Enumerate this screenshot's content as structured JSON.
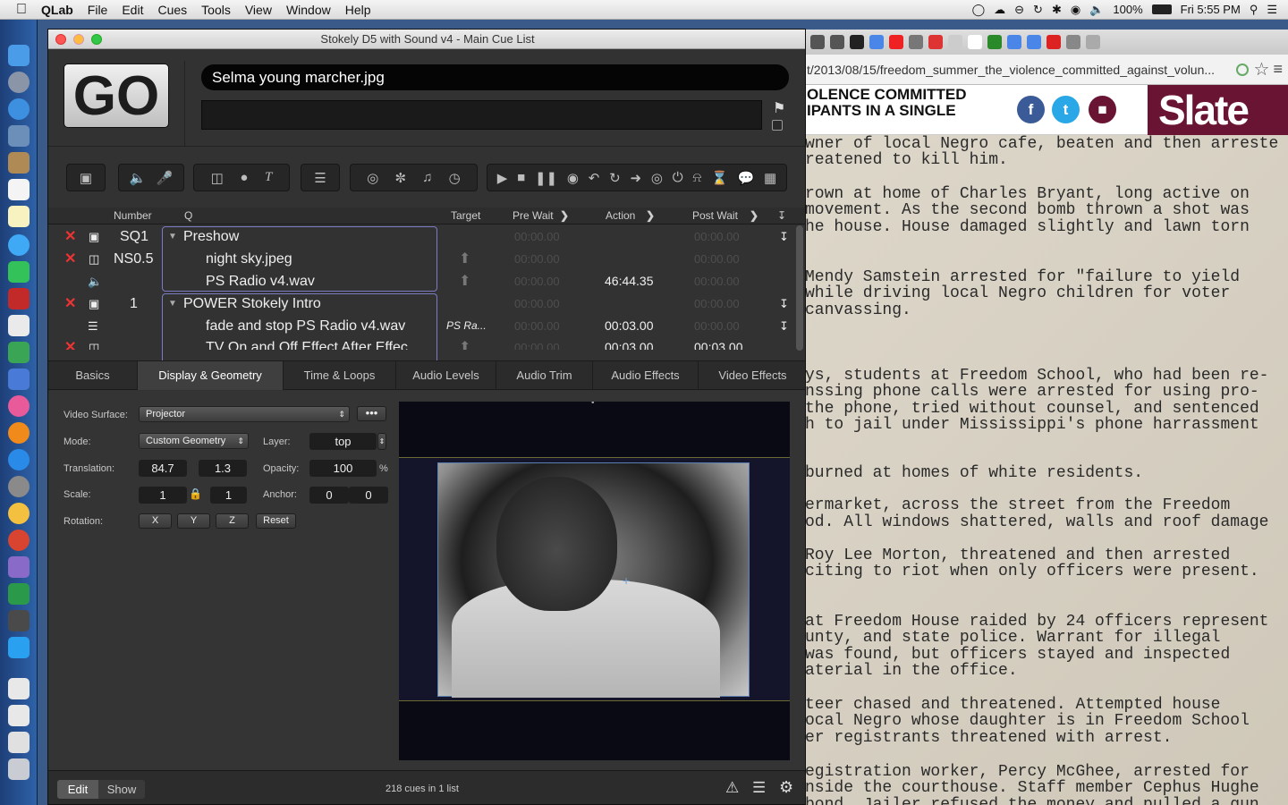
{
  "menubar": {
    "app_name": "QLab",
    "menus": [
      "File",
      "Edit",
      "Cues",
      "Tools",
      "View",
      "Window",
      "Help"
    ],
    "battery": "100%",
    "clock": "Fri 5:55 PM"
  },
  "qlab": {
    "window_title": "Stokely D5 with Sound v4 - Main Cue List",
    "go_label": "GO",
    "standby_cue_name": "Selma young marcher.jpg",
    "columns": {
      "number": "Number",
      "q": "Q",
      "target": "Target",
      "pre_wait": "Pre Wait",
      "action": "Action",
      "post_wait": "Post Wait"
    },
    "cues": [
      {
        "number": "SQ1",
        "name": "Preshow",
        "target": "",
        "pre_wait": "00:00.00",
        "action": "",
        "post_wait": "00:00.00"
      },
      {
        "number": "NS0.5",
        "name": "night sky.jpeg",
        "target": "",
        "pre_wait": "00:00.00",
        "action": "",
        "post_wait": "00:00.00"
      },
      {
        "number": "",
        "name": "PS Radio v4.wav",
        "target": "",
        "pre_wait": "00:00.00",
        "action": "46:44.35",
        "post_wait": "00:00.00"
      },
      {
        "number": "1",
        "name": "POWER Stokely Intro",
        "target": "",
        "pre_wait": "00:00.00",
        "action": "",
        "post_wait": "00:00.00"
      },
      {
        "number": "",
        "name": "fade and stop PS Radio v4.wav",
        "target": "PS Ra...",
        "pre_wait": "00:00.00",
        "action": "00:03.00",
        "post_wait": "00:00.00"
      },
      {
        "number": "",
        "name": "TV On and Off Effect After Effec...",
        "target": "",
        "pre_wait": "00:00.00",
        "action": "00:03.00",
        "post_wait": "00:03.00"
      }
    ],
    "inspector_tabs": [
      "Basics",
      "Display & Geometry",
      "Time & Loops",
      "Audio Levels",
      "Audio Trim",
      "Audio Effects",
      "Video Effects"
    ],
    "active_tab": "Display & Geometry",
    "display": {
      "video_surface_label": "Video Surface:",
      "video_surface": "Projector",
      "mode_label": "Mode:",
      "mode": "Custom Geometry",
      "layer_label": "Layer:",
      "layer": "top",
      "translation_label": "Translation:",
      "translation_x": "84.7",
      "translation_y": "1.3",
      "opacity_label": "Opacity:",
      "opacity": "100",
      "opacity_unit": "%",
      "scale_label": "Scale:",
      "scale_x": "1",
      "scale_y": "1",
      "anchor_label": "Anchor:",
      "anchor_x": "0",
      "anchor_y": "0",
      "rotation_label": "Rotation:",
      "rot_x": "X",
      "rot_y": "Y",
      "rot_z": "Z",
      "reset": "Reset"
    },
    "status": {
      "edit": "Edit",
      "show": "Show",
      "cue_count": "218 cues in 1 list"
    }
  },
  "browser": {
    "url": "t/2013/08/15/freedom_summer_the_violence_committed_against_volun...",
    "headline_lines": [
      "OLENCE COMMITTED",
      "IPANTS IN A SINGLE"
    ],
    "logo": "Slate",
    "document_lines": [
      "wner of local Negro cafe, beaten and then arreste",
      "reatened to kill him.",
      "rown at home of Charles Bryant, long active on",
      " movement. As the second bomb thrown a shot was",
      "he house. House damaged slightly and lawn torn",
      " Mendy Samstein arrested for \"failure to yield",
      " while driving local Negro children for voter",
      " canvassing.",
      "ys, students at Freedom School, who had been re-",
      "nssing phone calls were arrested for using pro-",
      "the phone, tried without counsel, and sentenced",
      "h to jail under Mississippi's phone harrassment",
      "burned at homes of white residents.",
      "ermarket, across the street from the Freedom",
      "od. All windows shattered, walls and roof damage",
      " Roy Lee Morton, threatened and then arrested",
      "citing to riot when only officers were present.",
      " at Freedom House raided by 24 officers represent",
      "unty, and state police. Warrant for illegal",
      " was found, but officers stayed and inspected",
      "aterial in the office.",
      "teer chased and threatened. Attempted house",
      "ocal Negro whose daughter is in Freedom School",
      "er registrants threatened with arrest.",
      "egistration worker, Percy McGhee, arrested for",
      "nside the courthouse. Staff member Cephus Hughe",
      "bond. Jailer refused the money and pulled a gun"
    ]
  }
}
